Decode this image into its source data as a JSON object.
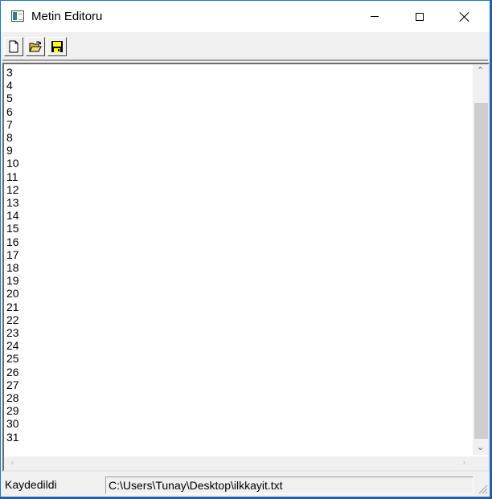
{
  "window": {
    "title": "Metin Editoru",
    "controls": {
      "minimize": "minimize",
      "maximize": "maximize",
      "close": "close"
    }
  },
  "toolbar": {
    "buttons": [
      {
        "icon": "new-file-icon"
      },
      {
        "icon": "open-folder-icon"
      },
      {
        "icon": "save-floppy-icon"
      }
    ]
  },
  "editor": {
    "lines": [
      "3",
      "4",
      "5",
      "6",
      "7",
      "8",
      "9",
      "10",
      "11",
      "12",
      "13",
      "14",
      "15",
      "16",
      "17",
      "18",
      "19",
      "20",
      "21",
      "22",
      "23",
      "24",
      "25",
      "26",
      "27",
      "28",
      "29",
      "30",
      "31"
    ]
  },
  "statusbar": {
    "status": "Kaydedildi",
    "path": "C:\\Users\\Tunay\\Desktop\\ilkkayit.txt"
  },
  "colors": {
    "titlebar": "#ffffff",
    "window_border": "#1979ca",
    "chrome": "#f0f0f0",
    "scroll_thumb": "#cdcdcd"
  }
}
